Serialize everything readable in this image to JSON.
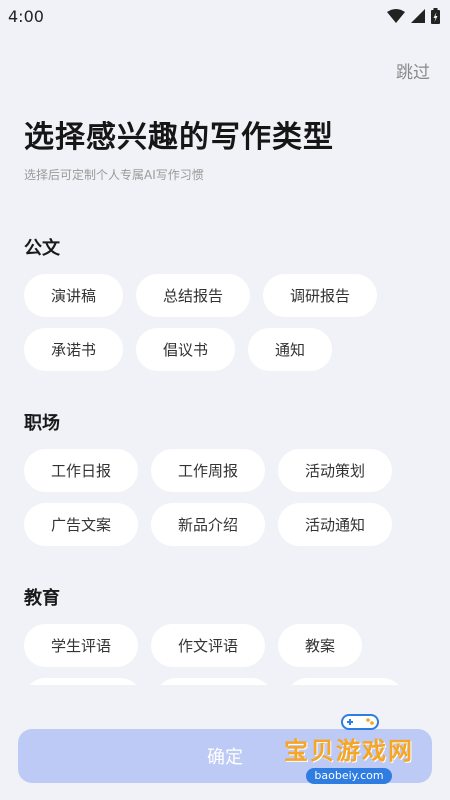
{
  "status_bar": {
    "time": "4:00"
  },
  "header": {
    "skip_label": "跳过"
  },
  "main": {
    "title": "选择感兴趣的写作类型",
    "subtitle": "选择后可定制个人专属AI写作习惯"
  },
  "sections": [
    {
      "title": "公文",
      "tags": [
        "演讲稿",
        "总结报告",
        "调研报告",
        "承诺书",
        "倡议书",
        "通知"
      ]
    },
    {
      "title": "职场",
      "tags": [
        "工作日报",
        "工作周报",
        "活动策划",
        "广告文案",
        "新品介绍",
        "活动通知"
      ]
    },
    {
      "title": "教育",
      "tags": [
        "学生评语",
        "作文评语",
        "教案",
        "",
        "",
        ""
      ]
    }
  ],
  "footer": {
    "confirm_label": "确定"
  },
  "watermark": {
    "text": "宝贝游戏网",
    "url": "baobeiy.com"
  },
  "colors": {
    "background": "#f1f2f7",
    "tag_bg": "#ffffff",
    "button": "#bccaf5",
    "watermark": "#f6a623"
  }
}
